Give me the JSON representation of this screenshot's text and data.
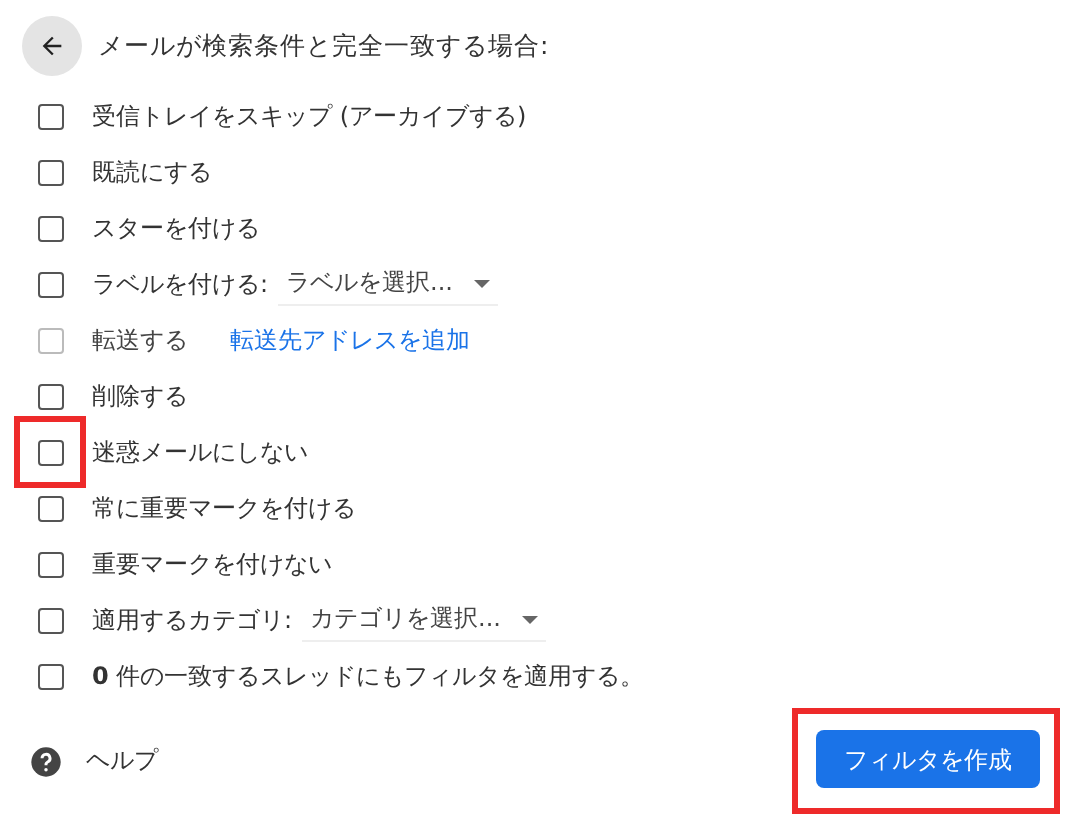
{
  "header": {
    "title": "メールが検索条件と完全一致する場合:"
  },
  "options": [
    {
      "kind": "plain",
      "label": "受信トレイをスキップ (アーカイブする)",
      "checked": false,
      "disabled": false,
      "highlighted": false
    },
    {
      "kind": "plain",
      "label": "既読にする",
      "checked": false,
      "disabled": false,
      "highlighted": false
    },
    {
      "kind": "plain",
      "label": "スターを付ける",
      "checked": false,
      "disabled": false,
      "highlighted": false
    },
    {
      "kind": "select",
      "label": "ラベルを付ける:",
      "select": "ラベルを選択...",
      "checked": false,
      "disabled": false,
      "highlighted": false
    },
    {
      "kind": "link",
      "label": "転送する",
      "link": "転送先アドレスを追加",
      "checked": false,
      "disabled": true,
      "highlighted": false
    },
    {
      "kind": "plain",
      "label": "削除する",
      "checked": false,
      "disabled": false,
      "highlighted": false
    },
    {
      "kind": "plain",
      "label": "迷惑メールにしない",
      "checked": false,
      "disabled": false,
      "highlighted": true
    },
    {
      "kind": "plain",
      "label": "常に重要マークを付ける",
      "checked": false,
      "disabled": false,
      "highlighted": false
    },
    {
      "kind": "plain",
      "label": "重要マークを付けない",
      "checked": false,
      "disabled": false,
      "highlighted": false
    },
    {
      "kind": "select",
      "label": "適用するカテゴリ:",
      "select": "カテゴリを選択...",
      "checked": false,
      "disabled": false,
      "highlighted": false
    },
    {
      "kind": "plain",
      "label": "**0** 件の一致するスレッドにもフィルタを適用する。",
      "checked": false,
      "disabled": false,
      "highlighted": false
    }
  ],
  "help": {
    "label": "ヘルプ"
  },
  "create_button": {
    "label": "フィルタを作成",
    "highlighted": true
  }
}
